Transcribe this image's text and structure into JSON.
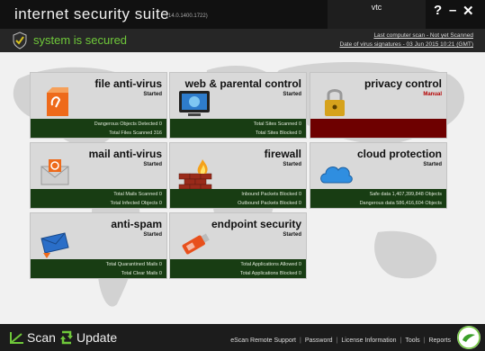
{
  "titlebar": {
    "title": "internet security suite",
    "version": "(14.0.1400.1722)",
    "user": "vtc",
    "help": "?",
    "minimize": "–",
    "close": "✕"
  },
  "status": {
    "text": "system is secured",
    "last_scan": "Last computer scan - Not yet Scanned",
    "signatures": "Date of  virus signatures - 03 Jun 2015 10:21 (GMT)"
  },
  "tiles": [
    {
      "name": "file anti-virus",
      "status": "Started",
      "line1": "Dangerous Objects Detected  0",
      "line2": "Total Files Scanned  316"
    },
    {
      "name": "web & parental control",
      "status": "Started",
      "line1": "Total Sites Scanned  0",
      "line2": "Total Sites Blocked  0"
    },
    {
      "name": "privacy control",
      "status": "Manual",
      "line1": "",
      "line2": ""
    },
    {
      "name": "mail anti-virus",
      "status": "Started",
      "line1": "Total Mails Scanned  0",
      "line2": "Total Infected Objects  0"
    },
    {
      "name": "firewall",
      "status": "Started",
      "line1": "Inbound Packets Blocked  0",
      "line2": "Outbound Packets Blocked  0"
    },
    {
      "name": "cloud protection",
      "status": "Started",
      "line1": "Safe data 1,407,399,848 Objects",
      "line2": "Dangerous data 586,416,604 Objects"
    },
    {
      "name": "anti-spam",
      "status": "Started",
      "line1": "Total Quarantined Mails  0",
      "line2": "Total Clear Mails  0"
    },
    {
      "name": "endpoint security",
      "status": "Started",
      "line1": "Total Applications Allowed  0",
      "line2": "Total Applications Blocked  0"
    }
  ],
  "bottom": {
    "scan": "Scan",
    "update": "Update",
    "links": [
      "eScan Remote Support",
      "Password",
      "License Information",
      "Tools",
      "Reports"
    ],
    "sep": "|"
  },
  "colors": {
    "accent_green": "#6fc83a",
    "footer_green": "#183d13",
    "manual_red": "#b40000"
  }
}
